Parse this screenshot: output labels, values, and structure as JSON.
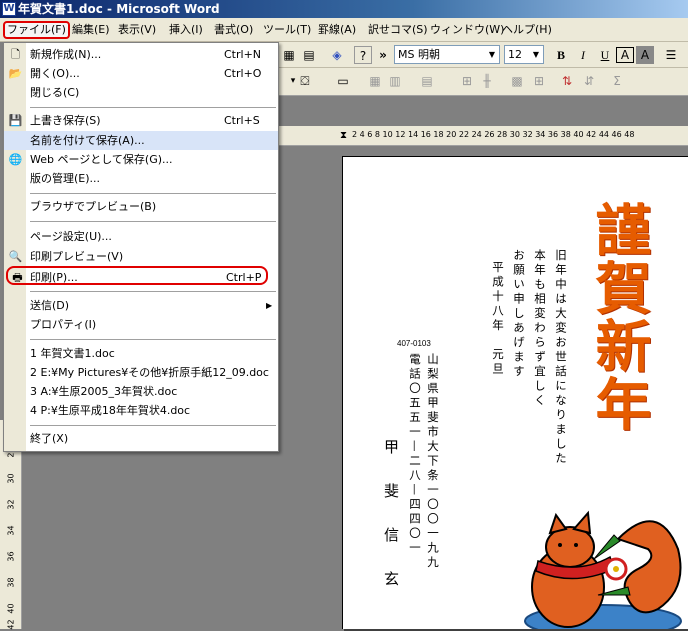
{
  "window": {
    "title": "年賀文書1.doc - Microsoft Word",
    "icon": "word-app-icon"
  },
  "menubar": [
    {
      "label": "ファイル(F)"
    },
    {
      "label": "編集(E)"
    },
    {
      "label": "表示(V)"
    },
    {
      "label": "挿入(I)"
    },
    {
      "label": "書式(O)"
    },
    {
      "label": "ツール(T)"
    },
    {
      "label": "罫線(A)"
    },
    {
      "label": "訳せコマ(S)"
    },
    {
      "label": "ウィンドウ(W)"
    },
    {
      "label": "ヘルプ(H)"
    }
  ],
  "toolbar": {
    "font_name": "MS 明朝",
    "font_size": "12",
    "bold": "B",
    "italic": "I",
    "underline": "U",
    "char_border": "A",
    "char_shade": "A",
    "more": "»",
    "help": "?",
    "sum": "Σ"
  },
  "ruler": {
    "ticks": "2  4  6  8  10  12  14  16  18  20  22  24  26  28  30  32  34  36  38  40  42  44  46  48"
  },
  "vruler": [
    "28",
    "30",
    "32",
    "34",
    "36",
    "38",
    "40",
    "42"
  ],
  "file_menu": {
    "items": [
      {
        "label": "新規作成(N)...",
        "shortcut": "Ctrl+N",
        "icon": "new-document-icon"
      },
      {
        "label": "開く(O)...",
        "shortcut": "Ctrl+O",
        "icon": "open-folder-icon"
      },
      {
        "label": "閉じる(C)",
        "shortcut": "",
        "icon": ""
      },
      {
        "label": "上書き保存(S)",
        "shortcut": "Ctrl+S",
        "icon": "save-disk-icon"
      },
      {
        "label": "名前を付けて保存(A)...",
        "shortcut": "",
        "icon": ""
      },
      {
        "label": "Web ページとして保存(G)...",
        "shortcut": "",
        "icon": "save-web-icon"
      },
      {
        "label": "版の管理(E)...",
        "shortcut": "",
        "icon": ""
      },
      {
        "label": "ブラウザでプレビュー(B)",
        "shortcut": "",
        "icon": ""
      },
      {
        "label": "ページ設定(U)...",
        "shortcut": "",
        "icon": ""
      },
      {
        "label": "印刷プレビュー(V)",
        "shortcut": "",
        "icon": "print-preview-icon"
      },
      {
        "label": "印刷(P)...",
        "shortcut": "Ctrl+P",
        "icon": "printer-icon"
      },
      {
        "label": "送信(D)",
        "shortcut": "",
        "icon": ""
      },
      {
        "label": "プロパティ(I)",
        "shortcut": "",
        "icon": ""
      },
      {
        "label": "1 年賀文書1.doc",
        "shortcut": "",
        "icon": ""
      },
      {
        "label": "2 E:¥My Pictures¥その他¥折原手紙12_09.doc",
        "shortcut": "",
        "icon": ""
      },
      {
        "label": "3 A:¥生原2005_3年賀状.doc",
        "shortcut": "",
        "icon": ""
      },
      {
        "label": "4 P:¥生原平成18年年賀状4.doc",
        "shortcut": "",
        "icon": ""
      },
      {
        "label": "終了(X)",
        "shortcut": "",
        "icon": ""
      }
    ]
  },
  "document": {
    "title": "謹賀新年",
    "greeting": [
      "旧年中は大変お世話になりました",
      "本年も相変わらず宜しく",
      "お願い申しあげます",
      "平成十八年　元旦"
    ],
    "postal_code": "407-0103",
    "address": "山梨県甲斐市大下条一〇〇一九九",
    "phone": "電話〇五五一—二八—四四〇一",
    "name": [
      "甲",
      "斐",
      "信",
      "玄"
    ]
  }
}
